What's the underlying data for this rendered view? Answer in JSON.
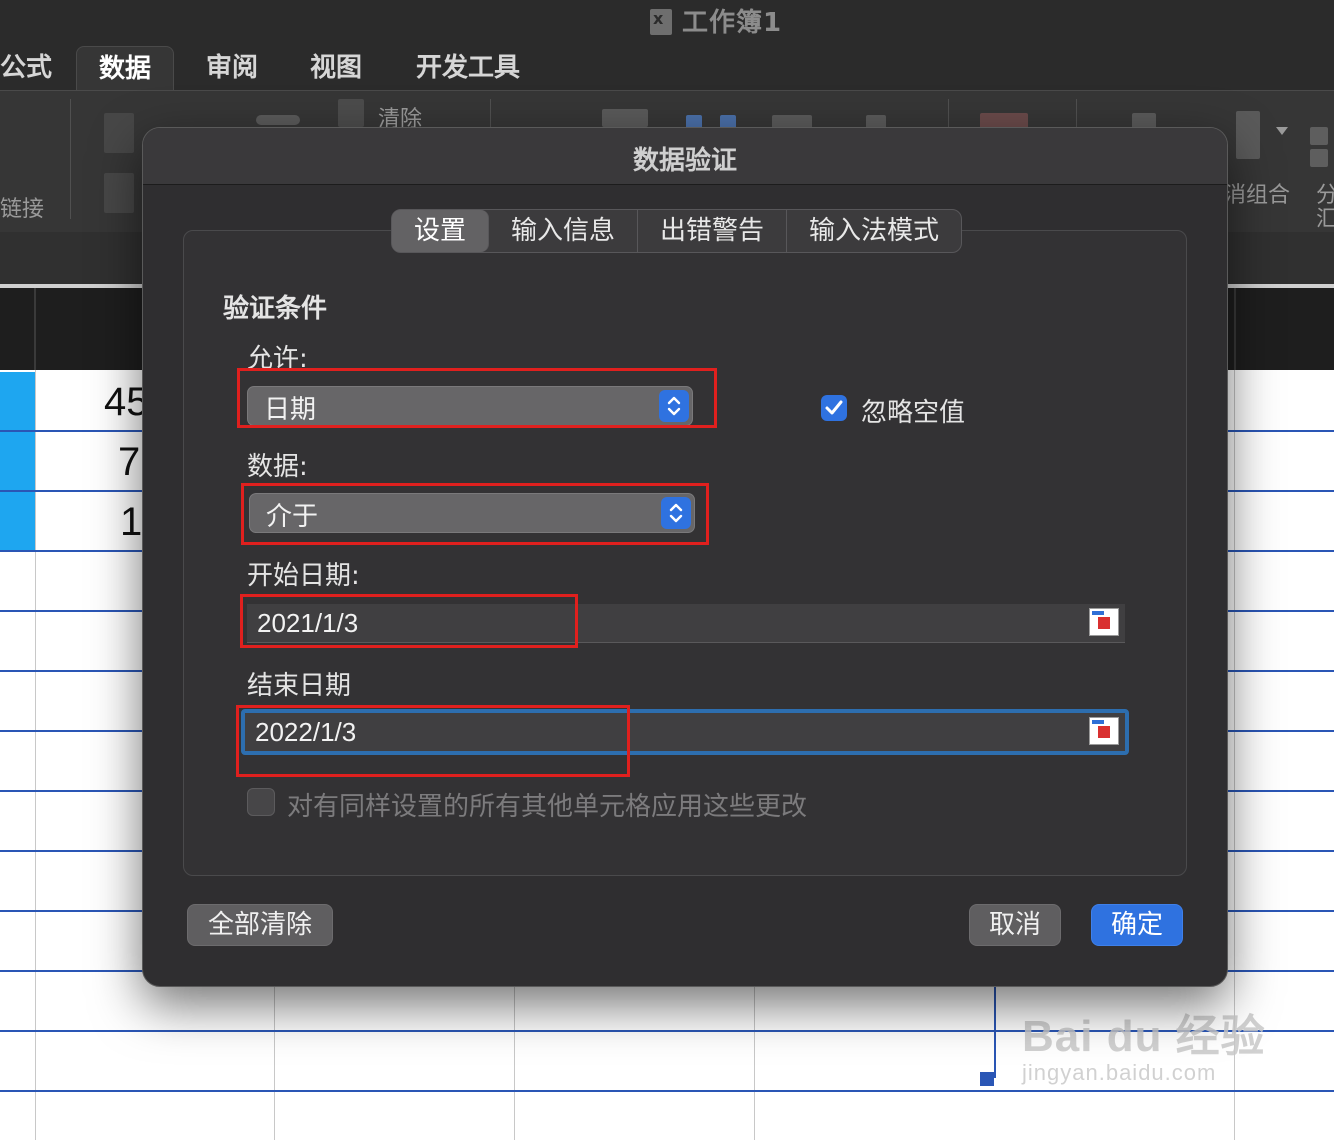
{
  "window": {
    "title": "工作簿1"
  },
  "ribbon_tabs": [
    {
      "label": "公式"
    },
    {
      "label": "数据",
      "active": true
    },
    {
      "label": "审阅"
    },
    {
      "label": "视图"
    },
    {
      "label": "开发工具"
    }
  ],
  "ribbon": {
    "clear_label": "清除",
    "links_label": "链接",
    "ungroup_label": "消组合",
    "subtotal_label_1": "分",
    "subtotal_label_2": "汇"
  },
  "sheet": {
    "visible_values": [
      "45",
      "7",
      "1"
    ],
    "selected_color": "#1ea6f0"
  },
  "dialog": {
    "title": "数据验证",
    "tabs": [
      {
        "label": "设置",
        "active": true
      },
      {
        "label": "输入信息"
      },
      {
        "label": "出错警告"
      },
      {
        "label": "输入法模式"
      }
    ],
    "section_title": "验证条件",
    "allow_label": "允许:",
    "allow_value": "日期",
    "ignore_blank_label": "忽略空值",
    "ignore_blank_checked": true,
    "data_label": "数据:",
    "data_value": "介于",
    "start_label": "开始日期:",
    "start_value": "2021/1/3",
    "end_label": "结束日期",
    "end_value": "2022/1/3",
    "apply_all_label": "对有同样设置的所有其他单元格应用这些更改",
    "apply_all_checked": false,
    "clear_all_button": "全部清除",
    "cancel_button": "取消",
    "ok_button": "确定"
  },
  "annotation_color": "#e0201e",
  "accent_color": "#2f72e0",
  "watermark": {
    "brand": "Bai du 经验",
    "url": "jingyan.baidu.com"
  }
}
